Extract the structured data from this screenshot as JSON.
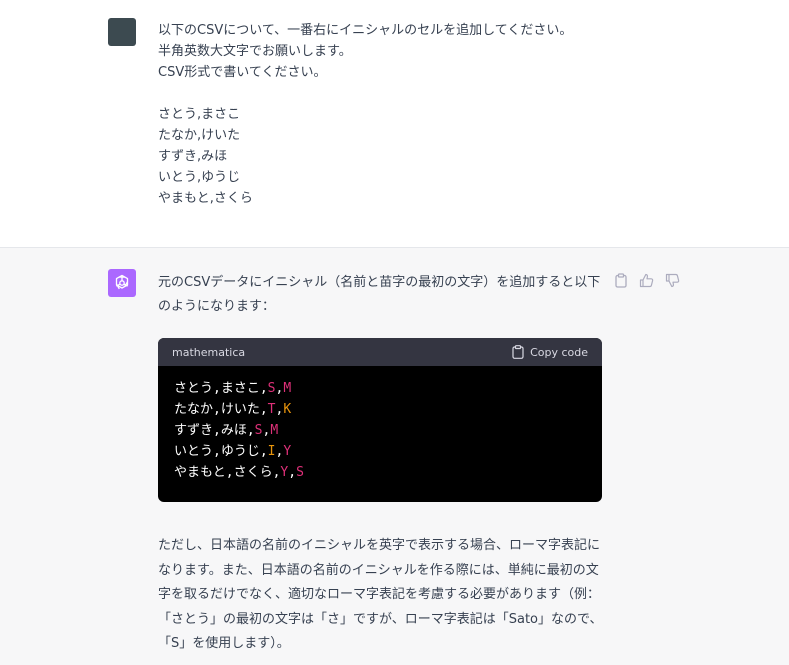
{
  "user_message": {
    "lines": [
      "以下のCSVについて、一番右にイニシャルのセルを追加してください。",
      "半角英数大文字でお願いします。",
      "CSV形式で書いてください。",
      "",
      "さとう,まさこ",
      "たなか,けいた",
      "すずき,みほ",
      "いとう,ゆうじ",
      "やまもと,さくら"
    ]
  },
  "assistant_message": {
    "intro": "元のCSVデータにイニシャル（名前と苗字の最初の文字）を追加すると以下のようになります：",
    "code_block": {
      "language": "mathematica",
      "copy_label": "Copy code",
      "lines": [
        {
          "text": "さとう,まさこ,",
          "i1": "S",
          "i1_color": "#df3079",
          "sep": ",",
          "i2": "M",
          "i2_color": "#df3079"
        },
        {
          "text": "たなか,けいた,",
          "i1": "T",
          "i1_color": "#df3079",
          "sep": ",",
          "i2": "K",
          "i2_color": "#e9950c"
        },
        {
          "text": "すずき,みほ,",
          "i1": "S",
          "i1_color": "#df3079",
          "sep": ",",
          "i2": "M",
          "i2_color": "#df3079"
        },
        {
          "text": "いとう,ゆうじ,",
          "i1": "I",
          "i1_color": "#e9950c",
          "sep": ",",
          "i2": "Y",
          "i2_color": "#df3079"
        },
        {
          "text": "やまもと,さくら,",
          "i1": "Y",
          "i1_color": "#df3079",
          "sep": ",",
          "i2": "S",
          "i2_color": "#df3079"
        }
      ]
    },
    "body": "ただし、日本語の名前のイニシャルを英字で表示する場合、ローマ字表記になります。また、日本語の名前のイニシャルを作る際には、単純に最初の文字を取るだけでなく、適切なローマ字表記を考慮する必要があります（例：「さとう」の最初の文字は「さ」ですが、ローマ字表記は「Sato」なので、「S」を使用します）。"
  },
  "icons": {
    "copy": "clipboard-icon",
    "thumbs_up": "thumbs-up-icon",
    "thumbs_down": "thumbs-down-icon",
    "assistant_logo": "openai-logo-icon"
  },
  "colors": {
    "assistant_avatar": "#ab68ff",
    "user_avatar": "#3c4a50",
    "code_background": "#000000",
    "code_header": "#343541"
  }
}
